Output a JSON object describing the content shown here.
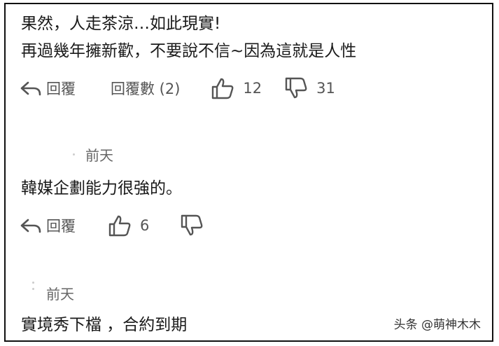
{
  "comments": [
    {
      "lines": [
        "果然，人走茶涼…如此現實!",
        "再過幾年擁新歡，不要說不信~因為這就是人性"
      ],
      "reply_label": "回覆",
      "replies_label": "回覆數 (2)",
      "likes": "12",
      "dislikes": "31"
    },
    {
      "time": "前天",
      "lines": [
        "韓媒企劃能力很強的。"
      ],
      "reply_label": "回覆",
      "likes": "6"
    },
    {
      "time": "前天",
      "lines": [
        "實境秀下檔 ，合約到期"
      ]
    }
  ],
  "watermark": "头条 @萌神木木",
  "icons": {
    "reply": "reply-arrow-icon",
    "like": "thumbs-up-icon",
    "dislike": "thumbs-down-icon"
  },
  "colors": {
    "text": "#1a1a1a",
    "meta": "#666666",
    "border": "#111111"
  }
}
